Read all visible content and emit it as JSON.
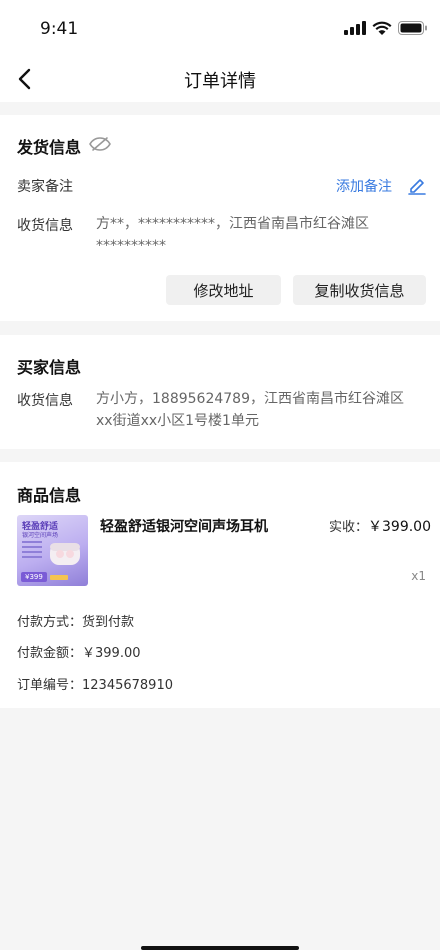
{
  "status": {
    "time": "9:41"
  },
  "nav": {
    "title": "订单详情"
  },
  "shipping": {
    "title": "发货信息",
    "seller_note_label": "卖家备注",
    "add_note": "添加备注",
    "receiver_label": "收货信息",
    "receiver_line1": "方**，***********，江西省南昌市红谷滩区",
    "receiver_line2": "**********",
    "edit_address": "修改地址",
    "copy_receiver": "复制收货信息"
  },
  "buyer": {
    "title": "买家信息",
    "receiver_label": "收货信息",
    "receiver_line1": "方小方，18895624789，江西省南昌市红谷滩区",
    "receiver_line2": "xx街道xx小区1号楼1单元"
  },
  "product": {
    "title": "商品信息",
    "name": "轻盈舒适银河空间声场耳机",
    "received_label": "实收：",
    "price": "￥399.00",
    "quantity": "x1",
    "thumb": {
      "headline": "轻盈舒适",
      "subline": "银河空间声场",
      "price_tag": "¥399"
    },
    "payment_method": "付款方式：货到付款",
    "payment_amount": "付款金额：￥399.00",
    "order_number": "订单编号：12345678910"
  },
  "colors": {
    "accent": "#3a7be0",
    "background": "#f5f5f5"
  }
}
